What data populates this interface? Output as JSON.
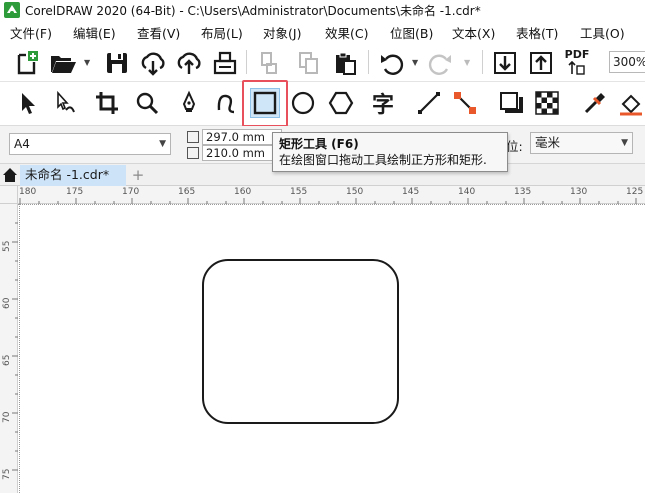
{
  "window": {
    "title": "CorelDRAW 2020 (64-Bit) - C:\\Users\\Administrator\\Documents\\未命名 -1.cdr*"
  },
  "menu": {
    "items": [
      "文件(F)",
      "编辑(E)",
      "查看(V)",
      "布局(L)",
      "对象(J)",
      "效果(C)",
      "位图(B)",
      "文本(X)",
      "表格(T)",
      "工具(O)"
    ]
  },
  "toolbar": {
    "zoom": "300%",
    "pdf_label": "PDF"
  },
  "toolbox": {
    "text_tool_glyph": "字"
  },
  "property_bar": {
    "page_size": "A4",
    "width": "297.0 mm",
    "height": "210.0 mm",
    "units_label": "位:",
    "units_value": "毫米"
  },
  "tooltip": {
    "title": "矩形工具 (F6)",
    "description": "在绘图窗口拖动工具绘制正方形和矩形."
  },
  "tabs": {
    "document": "未命名 -1.cdr*",
    "add": "+"
  },
  "ruler": {
    "h_labels": [
      "180",
      "175",
      "170",
      "165",
      "160",
      "155",
      "150",
      "145",
      "140",
      "135",
      "130",
      "125"
    ],
    "v_labels": [
      "55",
      "60",
      "65",
      "70",
      "75"
    ]
  },
  "colors": {
    "accent_highlight": "#e8505b",
    "active_tab": "#cde3f7",
    "selected_tool": "#cfe6f8",
    "app_icon_green": "#2e9b3a"
  }
}
